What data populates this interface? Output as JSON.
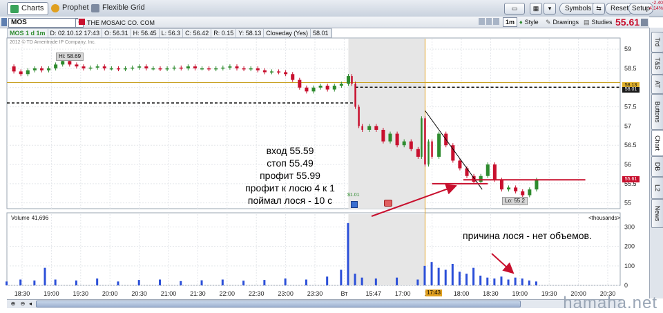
{
  "toolbar": {
    "tabs": [
      {
        "label": "Charts",
        "icon": "charts-icon",
        "active": true
      },
      {
        "label": "Prophet",
        "icon": "prophet-icon",
        "active": false
      },
      {
        "label": "Flexible Grid",
        "icon": "grid-icon",
        "active": false
      }
    ],
    "buttons": {
      "symbols": "Symbols",
      "reset": "Reset",
      "setup": "Setup"
    },
    "last_price": "55.61",
    "change": "-2.40",
    "change_pct": "-4.14%"
  },
  "symbol_bar": {
    "symbol": "MOS",
    "company": "THE MOSAIC CO. COM",
    "timeframe_button": "1m",
    "style_label": "Style",
    "drawings_label": "Drawings",
    "studies_label": "Studies",
    "price": "55.61"
  },
  "info_bar": {
    "symbol_tf": "MOS 1 d 1m",
    "date": "D: 02.10.12 17:43",
    "open": "O: 56.31",
    "high": "H: 56.45",
    "low": "L: 56.3",
    "close": "C: 56.42",
    "range": "R: 0.15",
    "y": "Y: 58.13",
    "closeday": "Closeday (Yes)",
    "closeday_val": "58.01"
  },
  "copyright": "2012 © TD Ameritrade IP Company, Inc.",
  "side_tabs": [
    "Trd",
    "T&S",
    "AT",
    "Buttons",
    "Chart",
    "DB",
    "L2",
    "News"
  ],
  "annotations": {
    "entry_lines": [
      "вход 55.59",
      "стоп 55.49",
      "профит 55.99",
      "профит к лосю 4 к 1",
      "поймал лося - 10 с"
    ],
    "volume_note": "причина лося - нет объемов.",
    "high_label": "Hi: 58.69",
    "low_label": "Lo: 55.2",
    "event_label": "$1.01"
  },
  "volume_header": {
    "label": "Volume",
    "value": "41,696",
    "units": "<thousands>"
  },
  "time_cursor": "17:43",
  "watermark": "hamaha.net",
  "colors": {
    "price": "#2e8b2e",
    "down": "#c8102e",
    "volume": "#2b4fd8",
    "prev_close": "#c8a020",
    "trendline_red": "#c8102e",
    "downtrend": "#000000"
  },
  "chart_data": {
    "type": "line",
    "title": "",
    "xlabel": "",
    "ylabel": "",
    "x_ticks": [
      "18:30",
      "19:00",
      "19:30",
      "20:00",
      "20:30",
      "21:00",
      "21:30",
      "22:00",
      "22:30",
      "23:00",
      "23:30",
      "Вт",
      "15:47",
      "17:00",
      "17:30",
      "18:00",
      "18:30",
      "19:00",
      "19:30",
      "20:00",
      "20:30"
    ],
    "price_ticks": [
      55,
      55.5,
      56,
      56.5,
      57,
      57.5,
      58,
      58.5,
      59
    ],
    "ylim": [
      54.85,
      59.2
    ],
    "volume_ticks": [
      0,
      100,
      200,
      300
    ],
    "volume_ylim": [
      0,
      330
    ],
    "grid": true,
    "price_labels": {
      "last": "55.61",
      "prev_close": "58.13",
      "prev_close_2": "58.01"
    },
    "levels": {
      "prev_close": 58.13,
      "dashed_prior": 57.6,
      "dashed_after": 58.01,
      "support": 55.6
    },
    "series": [
      {
        "name": "MOS 1m",
        "x": [
          0,
          10,
          20,
          30,
          40,
          50,
          60,
          70,
          80,
          90,
          100,
          110,
          120,
          130,
          140,
          150,
          160,
          170,
          180,
          190,
          200,
          210,
          220,
          230,
          240,
          250,
          260,
          270,
          280,
          290,
          300,
          310,
          320,
          330,
          340,
          350,
          360,
          370,
          380,
          390,
          400,
          410,
          420,
          430,
          440,
          450,
          460,
          470,
          480,
          490,
          495,
          500,
          505,
          510,
          520,
          530,
          540,
          550,
          560,
          570,
          580,
          590,
          595,
          600,
          605,
          610,
          620,
          630,
          640,
          650,
          660,
          670,
          680,
          690,
          700,
          710,
          720,
          730,
          740,
          750,
          760
        ],
        "values": [
          58.55,
          58.42,
          58.35,
          58.45,
          58.5,
          58.45,
          58.5,
          58.6,
          58.69,
          58.6,
          58.55,
          58.5,
          58.52,
          58.55,
          58.5,
          58.5,
          58.48,
          58.5,
          58.52,
          58.55,
          58.5,
          58.5,
          58.48,
          58.5,
          58.52,
          58.5,
          58.55,
          58.5,
          58.5,
          58.48,
          58.5,
          58.52,
          58.55,
          58.5,
          58.48,
          58.5,
          58.45,
          58.4,
          58.42,
          58.4,
          58.35,
          58.2,
          58.0,
          57.9,
          58.0,
          58.05,
          57.95,
          58.05,
          58.1,
          58.3,
          58.1,
          57.5,
          57.0,
          56.9,
          57.0,
          56.9,
          56.6,
          56.8,
          56.5,
          56.6,
          56.4,
          56.2,
          57.2,
          56.0,
          56.6,
          56.2,
          56.8,
          56.5,
          56.1,
          55.9,
          55.7,
          55.55,
          55.7,
          56.0,
          55.6,
          55.35,
          55.4,
          55.3,
          55.2,
          55.35,
          55.6
        ]
      },
      {
        "name": "Volume",
        "x": [
          0,
          20,
          40,
          55,
          70,
          100,
          130,
          160,
          190,
          220,
          250,
          280,
          310,
          340,
          370,
          400,
          430,
          460,
          480,
          490,
          500,
          510,
          530,
          560,
          590,
          600,
          610,
          620,
          630,
          640,
          650,
          660,
          670,
          680,
          690,
          700,
          710,
          720,
          730,
          740,
          750,
          760
        ],
        "values": [
          20,
          30,
          25,
          90,
          30,
          25,
          35,
          20,
          28,
          30,
          22,
          26,
          30,
          24,
          28,
          35,
          30,
          45,
          80,
          320,
          60,
          40,
          35,
          40,
          30,
          100,
          120,
          90,
          80,
          110,
          70,
          60,
          90,
          50,
          40,
          35,
          45,
          30,
          40,
          35,
          25,
          20
        ]
      }
    ]
  }
}
